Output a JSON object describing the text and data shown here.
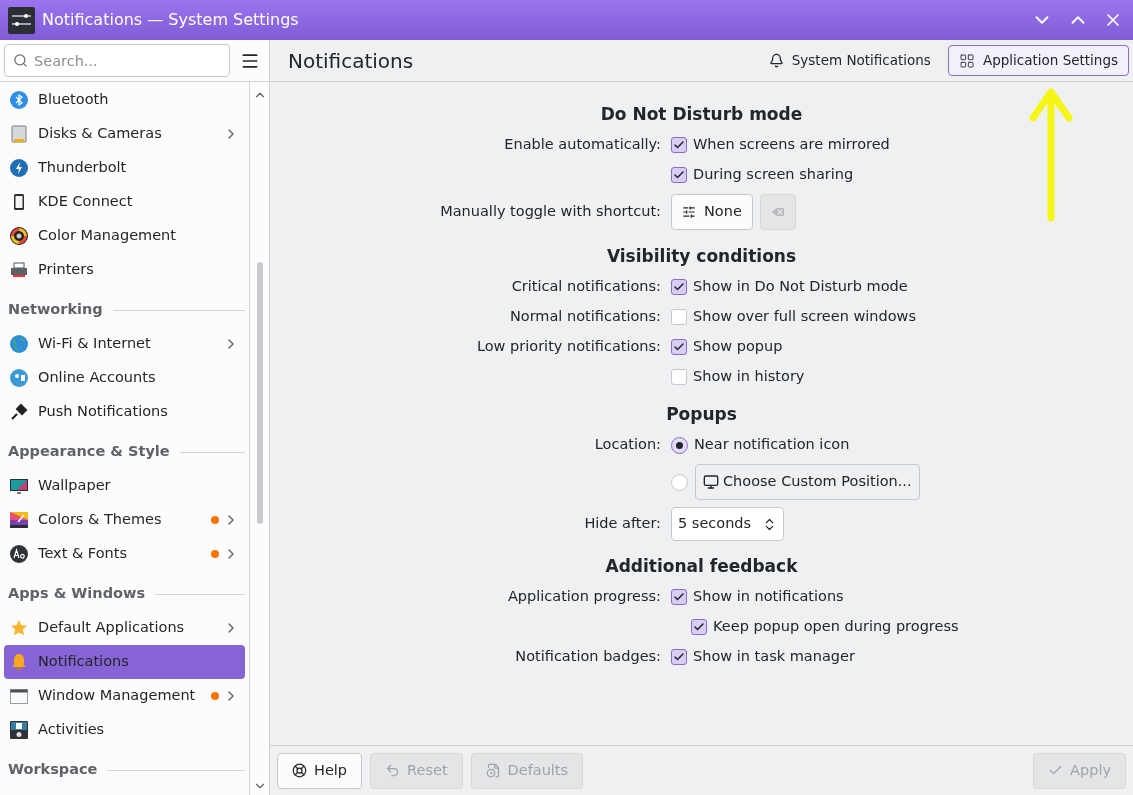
{
  "window": {
    "title": "Notifications — System Settings"
  },
  "search": {
    "placeholder": "Search..."
  },
  "sidebar": {
    "sections": [
      {
        "items": [
          {
            "label": "Bluetooth",
            "submenu": false,
            "changed": false,
            "selected": false
          },
          {
            "label": "Disks & Cameras",
            "submenu": true,
            "changed": false,
            "selected": false
          },
          {
            "label": "Thunderbolt",
            "submenu": false,
            "changed": false,
            "selected": false
          },
          {
            "label": "KDE Connect",
            "submenu": false,
            "changed": false,
            "selected": false
          },
          {
            "label": "Color Management",
            "submenu": false,
            "changed": false,
            "selected": false
          },
          {
            "label": "Printers",
            "submenu": false,
            "changed": false,
            "selected": false
          }
        ]
      },
      {
        "heading": "Networking",
        "items": [
          {
            "label": "Wi-Fi & Internet",
            "submenu": true,
            "changed": false,
            "selected": false
          },
          {
            "label": "Online Accounts",
            "submenu": false,
            "changed": false,
            "selected": false
          },
          {
            "label": "Push Notifications",
            "submenu": false,
            "changed": false,
            "selected": false
          }
        ]
      },
      {
        "heading": "Appearance & Style",
        "items": [
          {
            "label": "Wallpaper",
            "submenu": false,
            "changed": false,
            "selected": false
          },
          {
            "label": "Colors & Themes",
            "submenu": true,
            "changed": true,
            "selected": false
          },
          {
            "label": "Text & Fonts",
            "submenu": true,
            "changed": true,
            "selected": false
          }
        ]
      },
      {
        "heading": "Apps & Windows",
        "items": [
          {
            "label": "Default Applications",
            "submenu": true,
            "changed": false,
            "selected": false
          },
          {
            "label": "Notifications",
            "submenu": false,
            "changed": false,
            "selected": true
          },
          {
            "label": "Window Management",
            "submenu": true,
            "changed": true,
            "selected": false
          },
          {
            "label": "Activities",
            "submenu": false,
            "changed": false,
            "selected": false
          }
        ]
      },
      {
        "heading": "Workspace"
      }
    ]
  },
  "header": {
    "title": "Notifications",
    "buttons": [
      {
        "label": "System Notifications",
        "selected": false
      },
      {
        "label": "Application Settings",
        "selected": true
      }
    ]
  },
  "sections": [
    {
      "title": "Do Not Disturb mode",
      "rows": [
        {
          "kind": "checkbox",
          "label": "Enable automatically:",
          "text": "When screens are mirrored",
          "checked": true
        },
        {
          "kind": "checkbox",
          "text": "During screen sharing",
          "checked": true
        },
        {
          "kind": "shortcut",
          "label": "Manually toggle with shortcut:",
          "value": "None",
          "clear_disabled": true
        }
      ]
    },
    {
      "title": "Visibility conditions",
      "rows": [
        {
          "kind": "checkbox",
          "label": "Critical notifications:",
          "text": "Show in Do Not Disturb mode",
          "checked": true
        },
        {
          "kind": "checkbox",
          "label": "Normal notifications:",
          "text": "Show over full screen windows",
          "checked": false
        },
        {
          "kind": "checkbox",
          "label": "Low priority notifications:",
          "text": "Show popup",
          "checked": true
        },
        {
          "kind": "checkbox",
          "text": "Show in history",
          "checked": false
        }
      ]
    },
    {
      "title": "Popups",
      "rows": [
        {
          "kind": "radio",
          "label": "Location:",
          "text": "Near notification icon",
          "selected": true
        },
        {
          "kind": "radio-button",
          "button": "Choose Custom Position...",
          "selected": false
        },
        {
          "kind": "spin",
          "label": "Hide after:",
          "value": "5 seconds"
        }
      ]
    },
    {
      "title": "Additional feedback",
      "rows": [
        {
          "kind": "checkbox",
          "label": "Application progress:",
          "text": "Show in notifications",
          "checked": true
        },
        {
          "kind": "subcheckbox",
          "text": "Keep popup open during progress",
          "checked": true
        },
        {
          "kind": "checkbox",
          "label": "Notification badges:",
          "text": "Show in task manager",
          "checked": true
        }
      ]
    }
  ],
  "footer": {
    "buttons": [
      {
        "kind": "help",
        "label": "Help",
        "disabled": false
      },
      {
        "kind": "reset",
        "label": "Reset",
        "disabled": true
      },
      {
        "kind": "defaults",
        "label": "Defaults",
        "disabled": true
      },
      {
        "kind": "apply",
        "label": "Apply",
        "disabled": true
      }
    ]
  }
}
